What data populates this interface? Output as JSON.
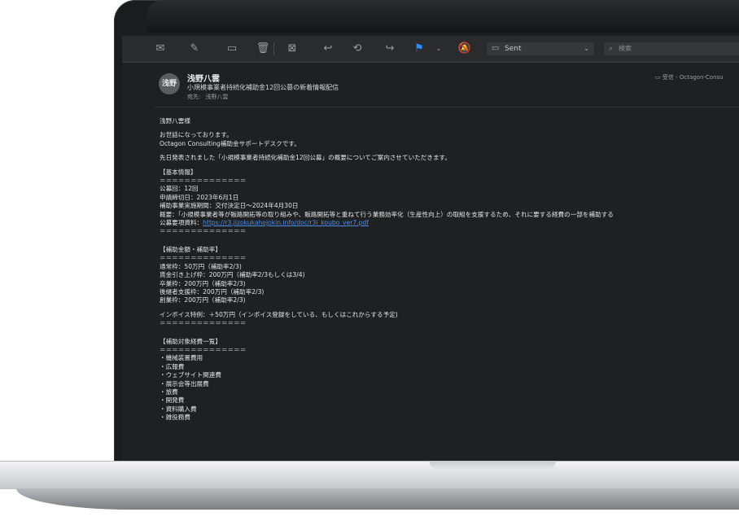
{
  "toolbar": {
    "icons": [
      "envelope-icon",
      "compose-icon",
      "archive-icon",
      "trash-icon",
      "junk-icon",
      "reply-icon",
      "reply-all-icon",
      "forward-icon",
      "flag-icon",
      "chevron-down-icon",
      "mute-icon"
    ],
    "mailbox_label": "Sent",
    "search_placeholder": "検索",
    "flag_color": "#2d8cff"
  },
  "header": {
    "avatar_initials": "浅野",
    "sender": "浅野八雲",
    "subject": "小規模事業者持続化補助金12回公募の新着情報配信",
    "to_label": "宛先:",
    "to_value": "浅野八雲",
    "mailbox_tag": "受信 - Octagon-Consu"
  },
  "body": {
    "greeting": "浅野八雲様",
    "intro1": "お世話になっております。",
    "intro2": "Octagon Consulting補助金サポートデスクです。",
    "intro3": "先日発表されました「小規模事業者持続化補助金12回公募」の概要についてご案内させていただきます。",
    "s1_title": "【基本情報】",
    "divider": "＝＝＝＝＝＝＝＝＝＝＝＝＝＝",
    "s1_l1": "公募回：12回",
    "s1_l2": "申請締切日：2023年6月1日",
    "s1_l3": "補助事業実施期間：交付決定日〜2024年4月30日",
    "s1_l4": "概要：「小規模事業者等が販路開拓等の取り組みや、販路開拓等と重ねて行う業務効率化（生産性向上）の取組を支援するため、それに要する経費の一部を補助する",
    "s1_l5_label": "公募要項資料：",
    "s1_l5_link": "https://r3.jizokukahojokin.info/doc/r3i_koubo_ver7.pdf",
    "s2_title": "【補助金額・補助率】",
    "s2_l1": "通常枠：50万円（補助率2/3)",
    "s2_l2": "賃金引き上げ枠：200万円（補助率2/3もしくは3/4)",
    "s2_l3": "卒業枠：200万円（補助率2/3)",
    "s2_l4": "後継者支援枠：200万円（補助率2/3)",
    "s2_l5": "創業枠：200万円（補助率2/3)",
    "s2_l6": "インボイス特例：＋50万円（インボイス登録をしている、もしくはこれからする予定)",
    "s3_title": "【補助対象経費一覧】",
    "s3_items": [
      "・機械装置費用",
      "・広報費",
      "・ウェブサイト関連費",
      "・展示会等出展費",
      "・旅費",
      "・開発費",
      "・資料購入費",
      "・雑役務費"
    ]
  }
}
